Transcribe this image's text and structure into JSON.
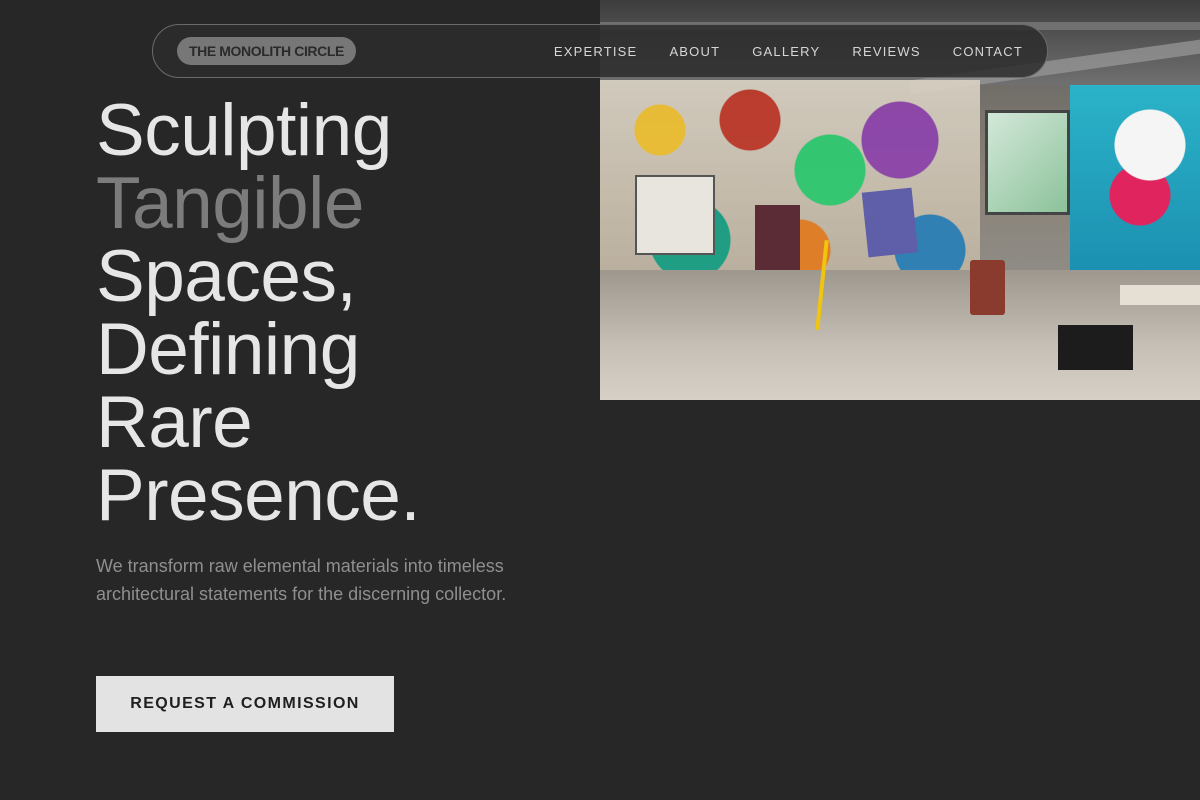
{
  "nav": {
    "logo": "THE MONOLITH CIRCLE",
    "links": [
      {
        "label": "EXPERTISE"
      },
      {
        "label": "ABOUT"
      },
      {
        "label": "GALLERY"
      },
      {
        "label": "REVIEWS"
      },
      {
        "label": "CONTACT"
      }
    ]
  },
  "hero": {
    "headline_lines": [
      "Sculpting",
      "Tangible",
      "Spaces,",
      "Defining",
      "Rare",
      "Presence."
    ],
    "highlight_line_index": 1,
    "subtext": "We transform raw elemental materials into timeless architectural statements for the discerning collector.",
    "cta_label": "REQUEST A COMMISSION",
    "image_subject": "graffiti-covered art studio interior"
  },
  "colors": {
    "background": "#272727",
    "headline": "#e6e6e6",
    "headline_muted": "#7c7c7c",
    "cta_background": "#e3e3e3"
  }
}
